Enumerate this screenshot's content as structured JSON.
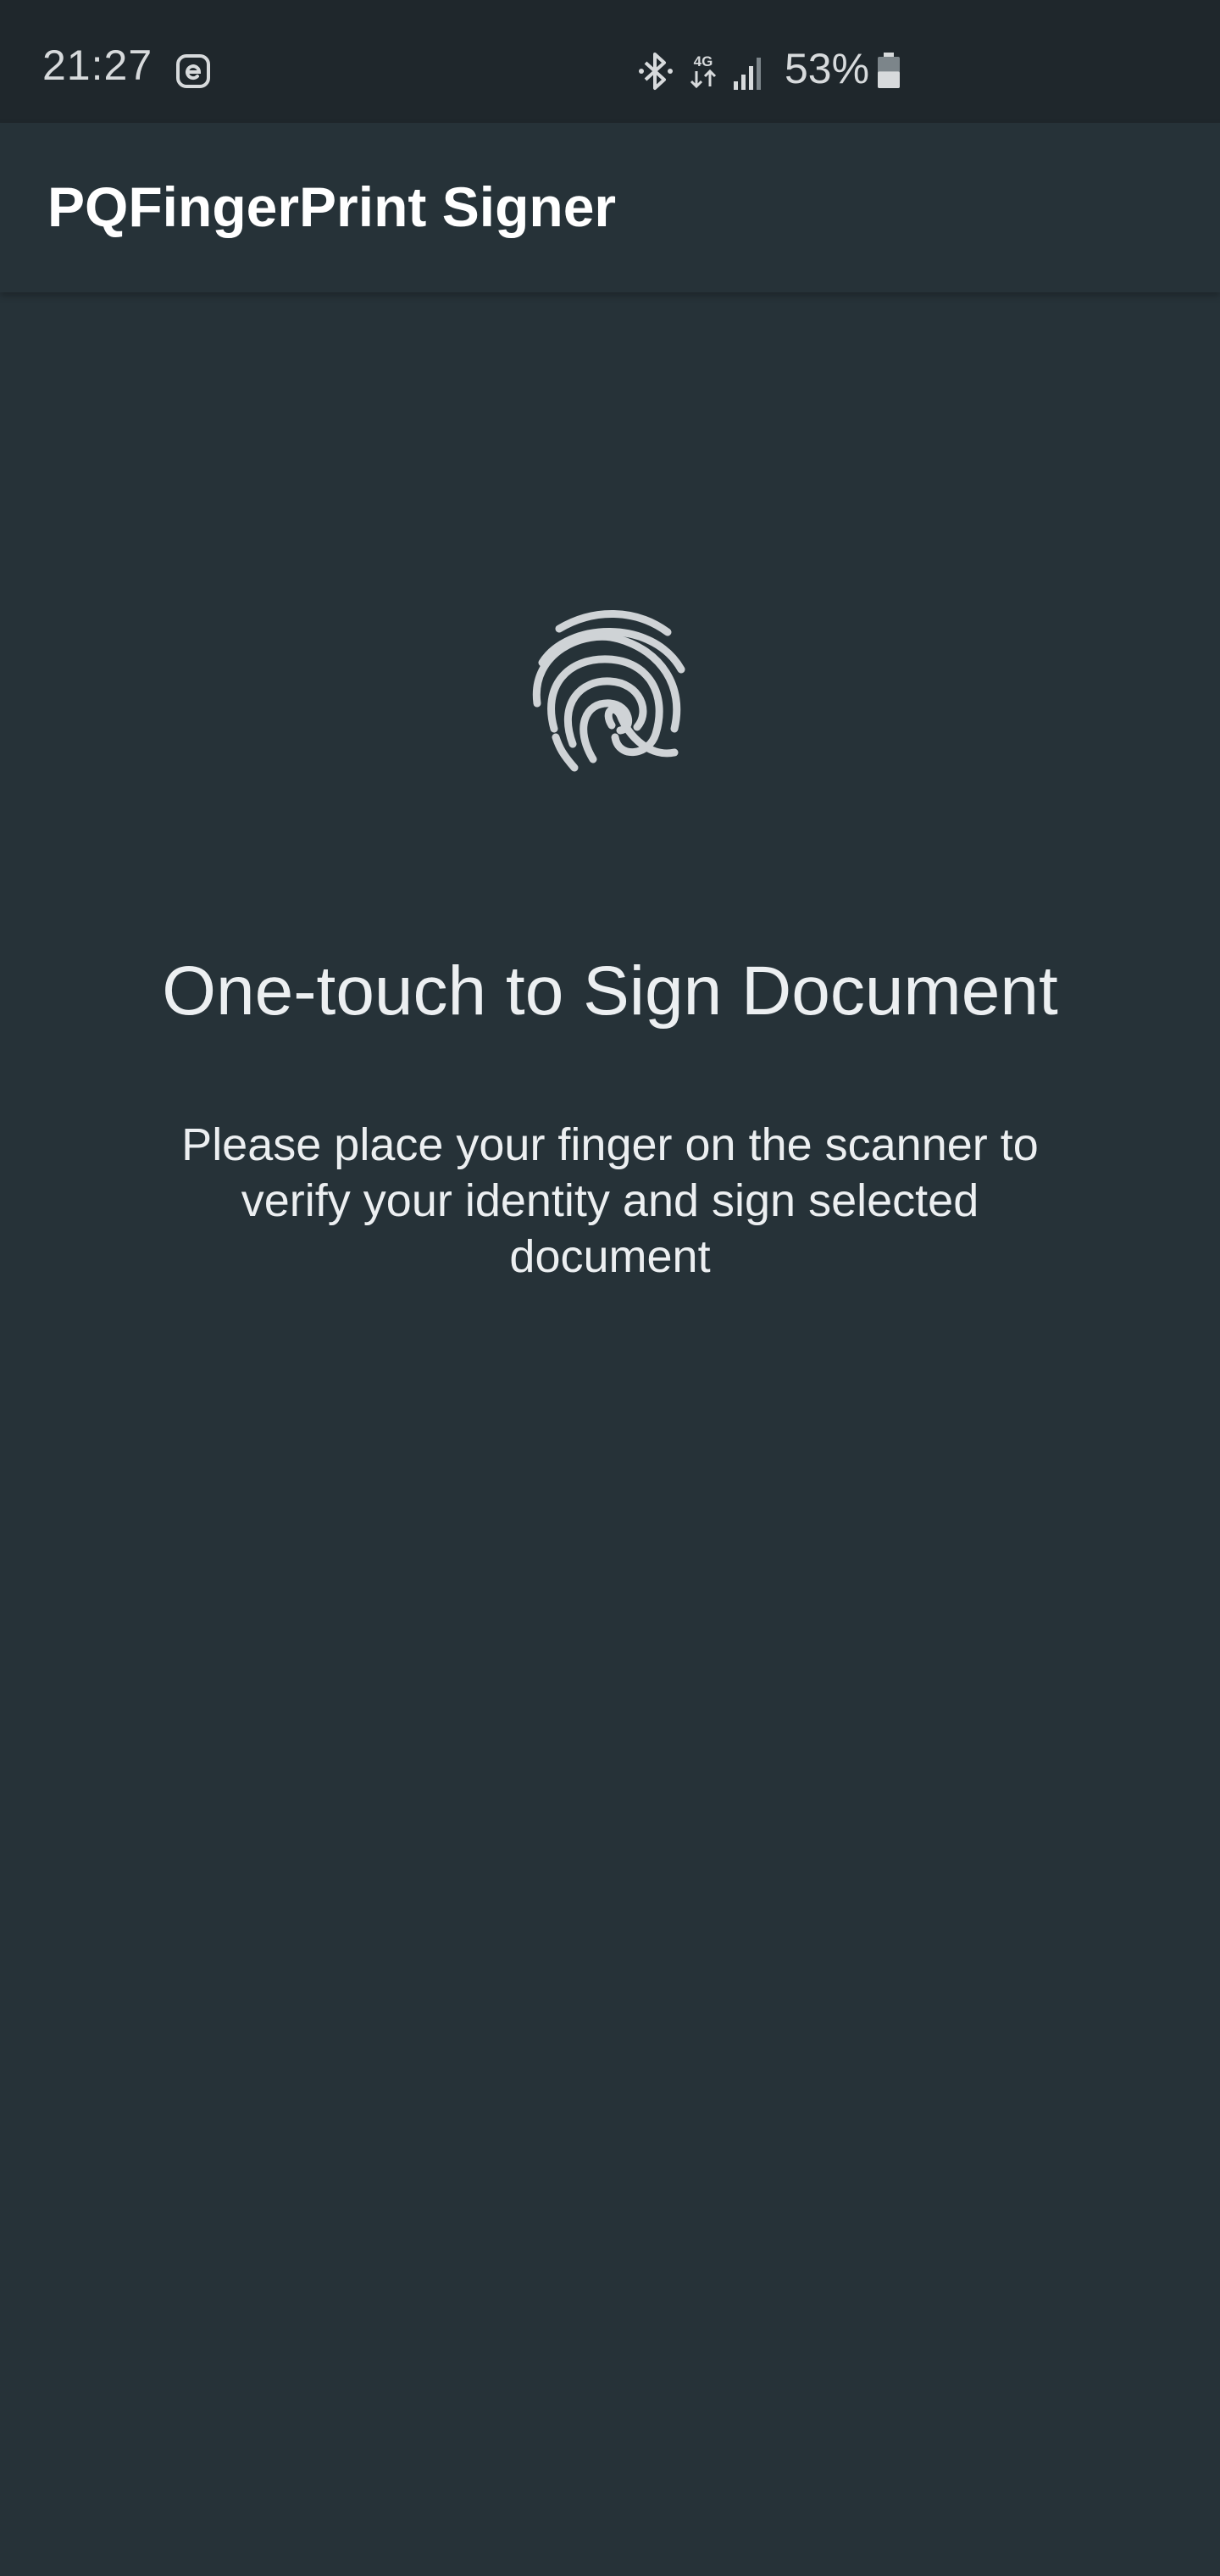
{
  "status_bar": {
    "time": "21:27",
    "network_type": "4G",
    "battery_percent": "53%",
    "battery_level": 0.53,
    "icons": [
      "e-notification-icon",
      "bluetooth-icon",
      "network-4g-icon",
      "signal-icon",
      "battery-icon"
    ]
  },
  "app_bar": {
    "title": "PQFingerPrint Signer"
  },
  "content": {
    "icon": "fingerprint-icon",
    "heading": "One-touch to Sign Document",
    "instructions": "Please place your finger on the scanner to verify your identity and sign selected document"
  },
  "colors": {
    "background": "#263238",
    "status_bar": "#1f272c",
    "text": "#eceff1",
    "icon": "#cfd3d6"
  }
}
